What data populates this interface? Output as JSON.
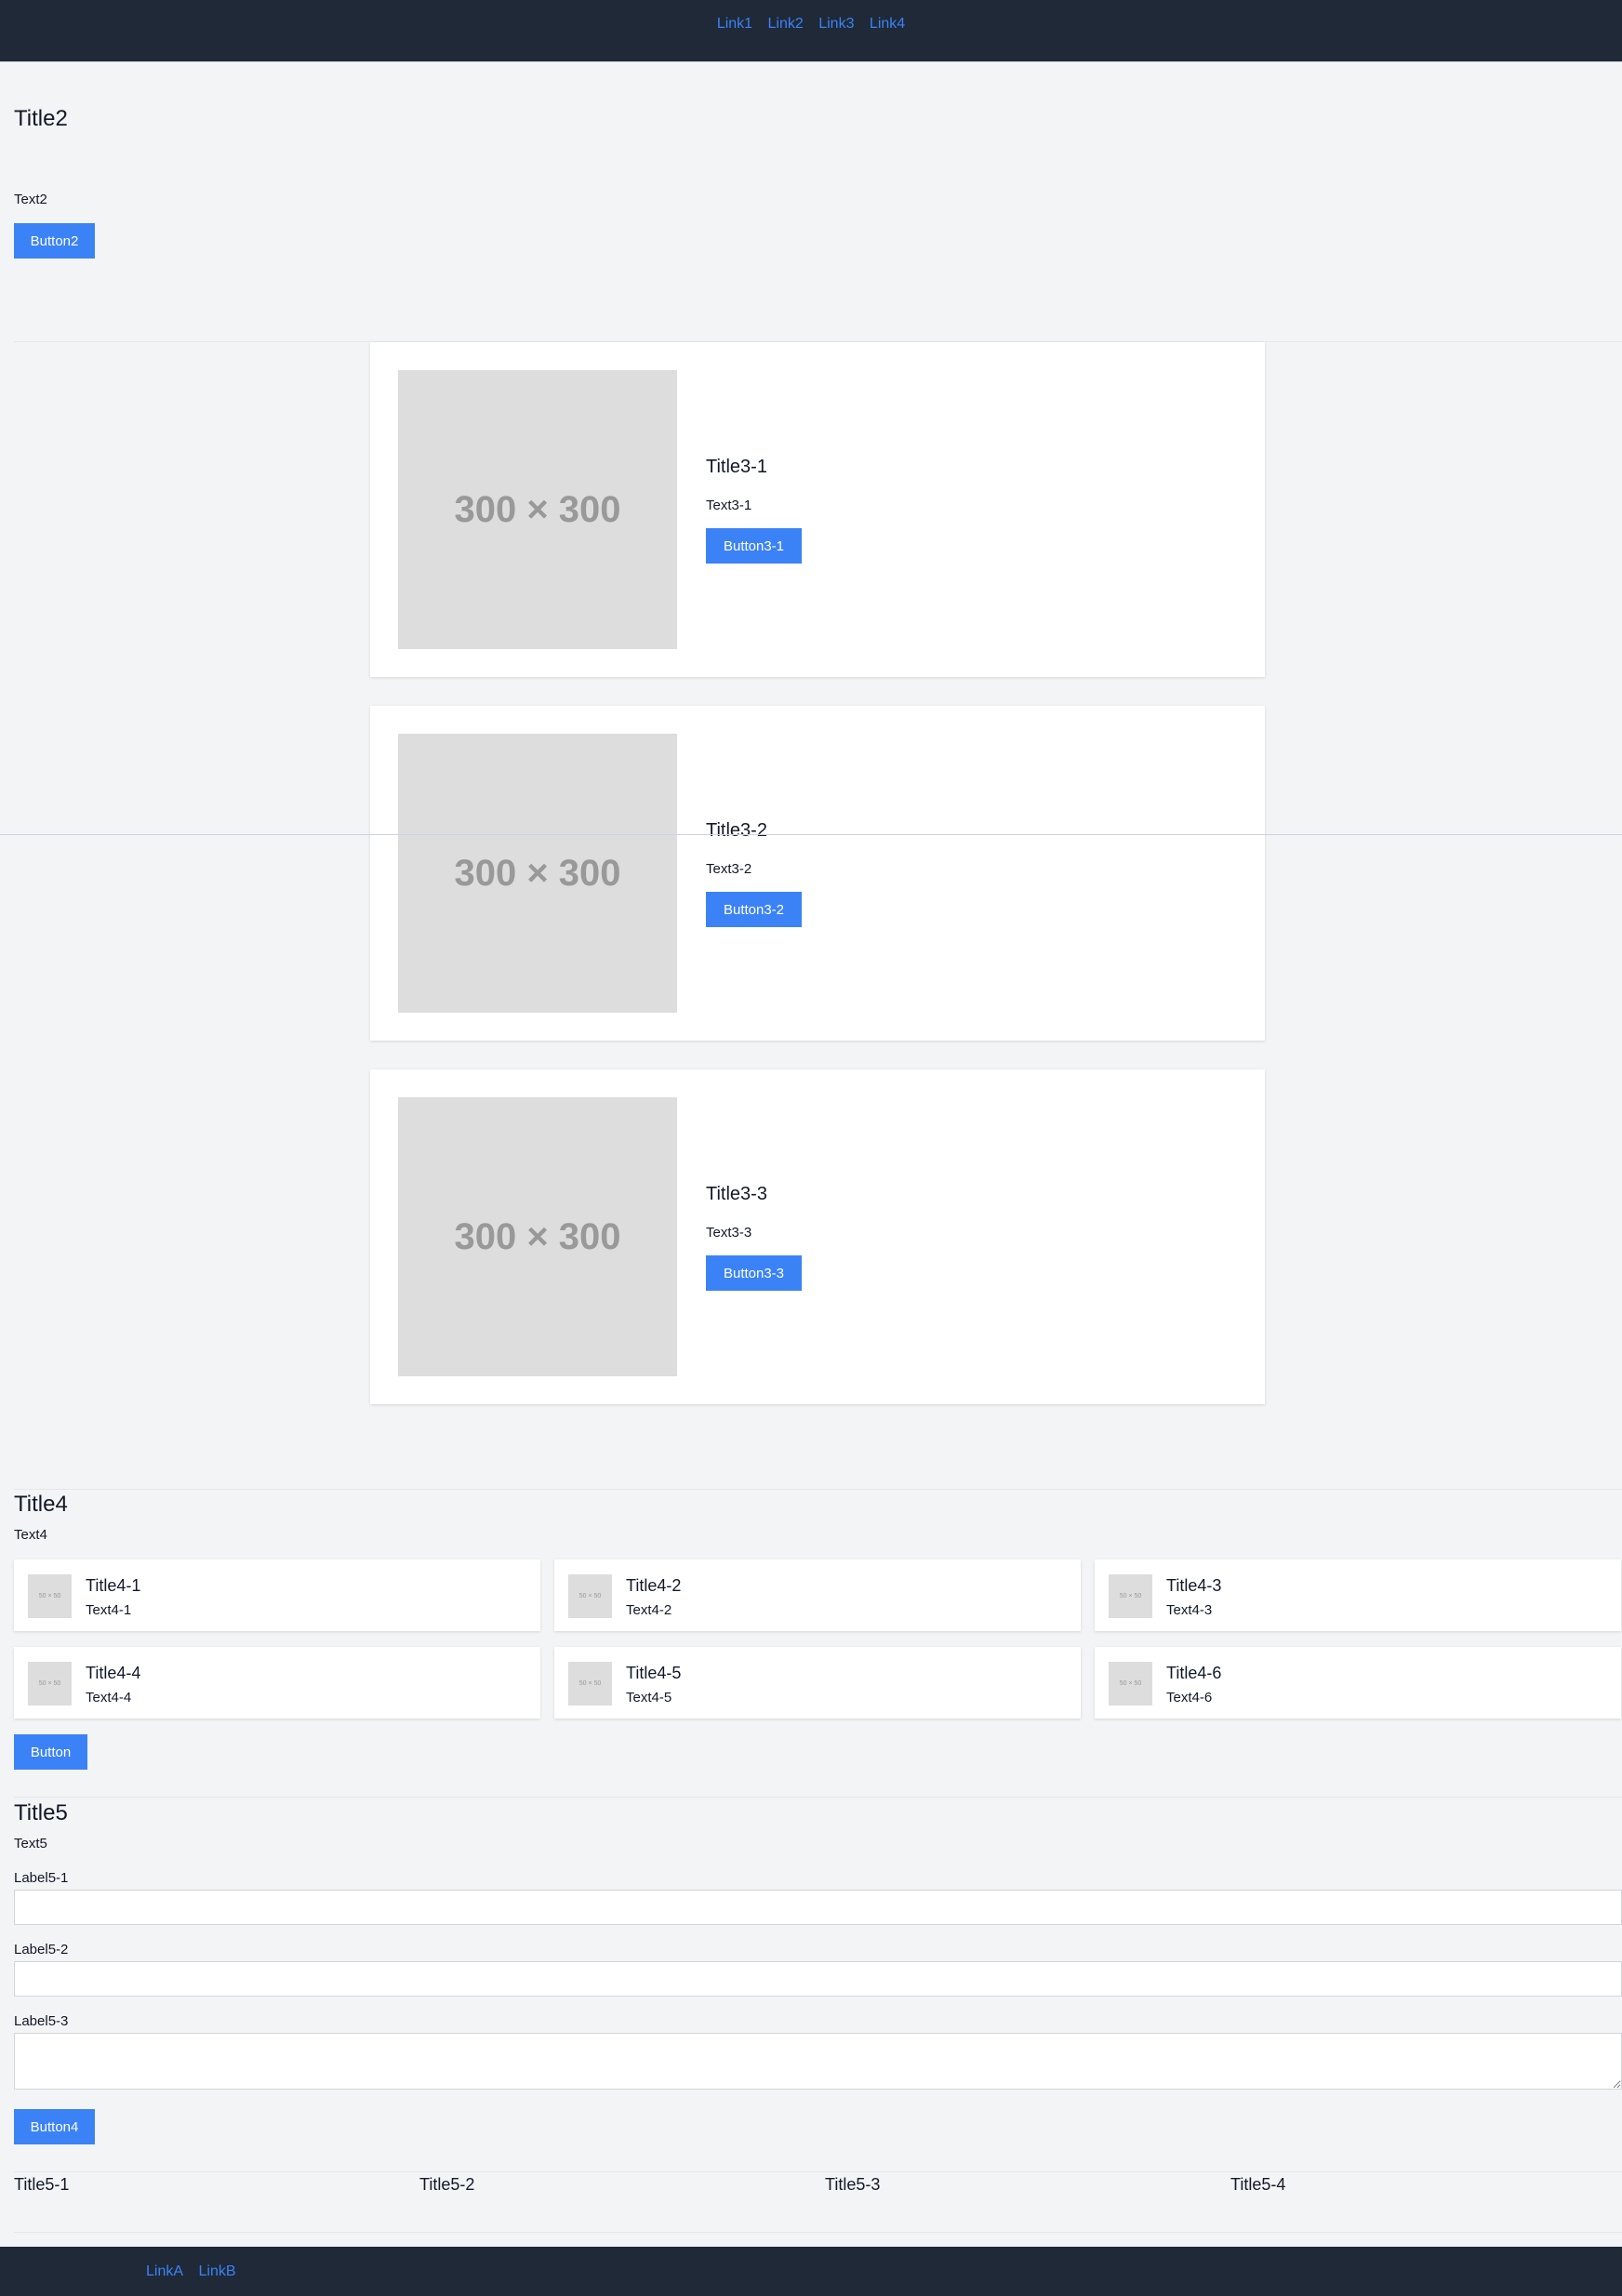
{
  "header": {
    "links": [
      "Link1",
      "Link2",
      "Link3",
      "Link4"
    ]
  },
  "hero": {
    "title": "Title2",
    "text": "Text2",
    "button": "Button2"
  },
  "features": [
    {
      "image": "300 × 300",
      "title": "Title3-1",
      "text": "Text3-1",
      "button": "Button3-1"
    },
    {
      "image": "300 × 300",
      "title": "Title3-2",
      "text": "Text3-2",
      "button": "Button3-2"
    },
    {
      "image": "300 × 300",
      "title": "Title3-3",
      "text": "Text3-3",
      "button": "Button3-3"
    }
  ],
  "section4": {
    "title": "Title4",
    "text": "Text4",
    "items": [
      {
        "image": "50 × 50",
        "title": "Title4-1",
        "text": "Text4-1"
      },
      {
        "image": "50 × 50",
        "title": "Title4-2",
        "text": "Text4-2"
      },
      {
        "image": "50 × 50",
        "title": "Title4-3",
        "text": "Text4-3"
      },
      {
        "image": "50 × 50",
        "title": "Title4-4",
        "text": "Text4-4"
      },
      {
        "image": "50 × 50",
        "title": "Title4-5",
        "text": "Text4-5"
      },
      {
        "image": "50 × 50",
        "title": "Title4-6",
        "text": "Text4-6"
      }
    ],
    "button": "Button"
  },
  "section5": {
    "title": "Title5",
    "text": "Text5",
    "fields": [
      {
        "label": "Label5-1",
        "value": "",
        "placeholder": ""
      },
      {
        "label": "Label5-2",
        "value": "",
        "placeholder": ""
      },
      {
        "label": "Label5-3",
        "value": "",
        "placeholder": ""
      }
    ],
    "button": "Button4",
    "columns": [
      "Title5-1",
      "Title5-2",
      "Title5-3",
      "Title5-4"
    ]
  },
  "footer": {
    "links": [
      "LinkA",
      "LinkB"
    ]
  }
}
